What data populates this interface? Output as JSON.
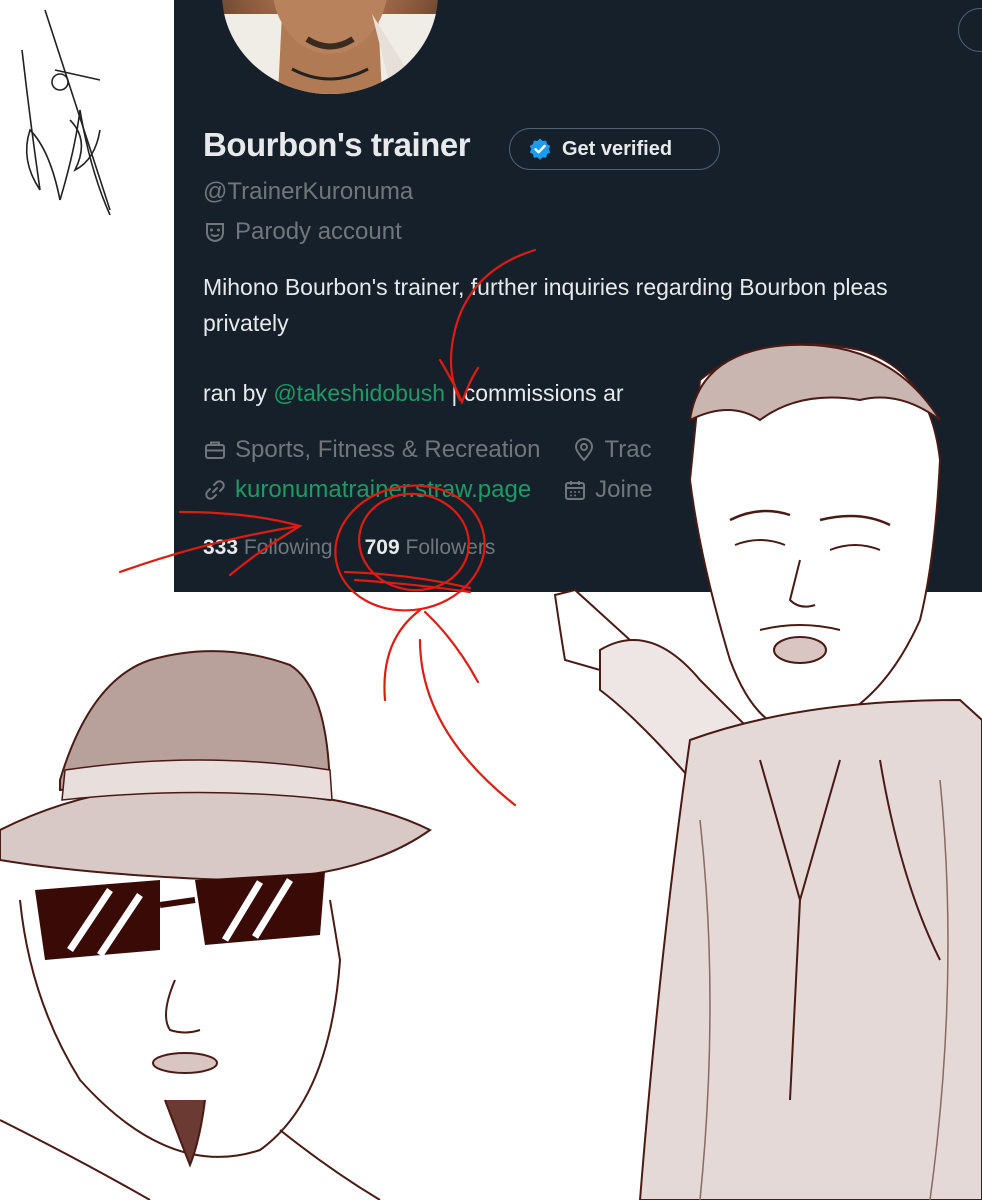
{
  "profile": {
    "display_name": "Bourbon's trainer",
    "verified_button_label": "Get verified",
    "handle": "@TrainerKuronuma",
    "parody_label": "Parody account",
    "bio_line1": "Mihono Bourbon's trainer, further inquiries regarding Bourbon pleas",
    "bio_line2": "privately",
    "bio_line3_prefix": "ran by ",
    "bio_mention": "@takeshidobush",
    "bio_line3_suffix": " | commissions ar",
    "category": "Sports, Fitness & Recreation",
    "location": "Trac",
    "website": "kuronumatrainer.straw.page",
    "joined": "Joine",
    "following_count": "333",
    "following_label": "Following",
    "followers_count": "709",
    "followers_label": "Followers"
  },
  "colors": {
    "card_bg": "#15202b",
    "primary_text": "#e7e9ea",
    "secondary_text": "#71767b",
    "link_green": "#1d9b64",
    "verified_blue": "#1d9bf0",
    "annotation_red": "#e01b12",
    "sketch_brown": "#4a1a14"
  },
  "icons": {
    "verified": "verified-badge-icon",
    "parody": "theater-mask-icon",
    "category": "briefcase-icon",
    "location": "location-pin-icon",
    "website": "link-icon",
    "joined": "calendar-icon"
  }
}
